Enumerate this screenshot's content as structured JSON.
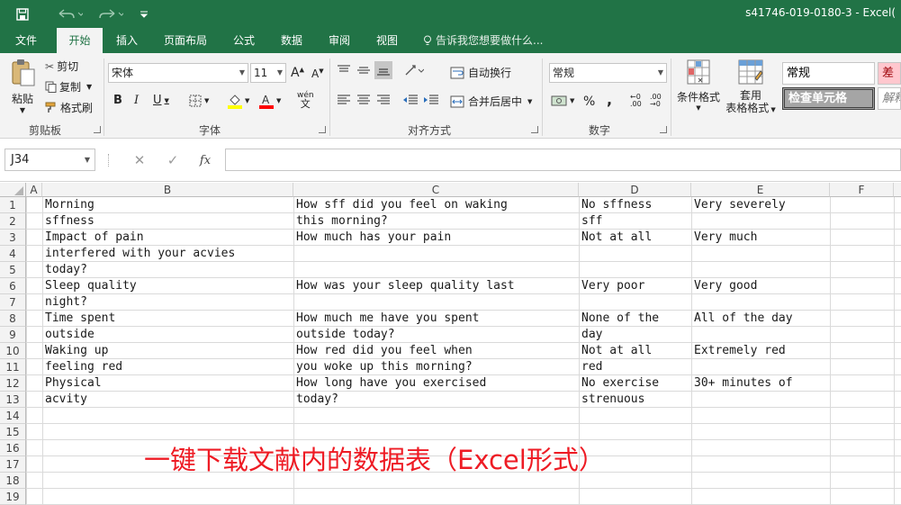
{
  "window": {
    "title": "s41746-019-0180-3 - Excel("
  },
  "quick_access": {
    "save": "save-icon",
    "undo": "undo-icon",
    "redo": "redo-icon",
    "customize": "customize-icon"
  },
  "tabs": [
    "文件",
    "开始",
    "插入",
    "页面布局",
    "公式",
    "数据",
    "审阅",
    "视图"
  ],
  "active_tab": "开始",
  "tell_me": "告诉我您想要做什么...",
  "ribbon": {
    "clipboard": {
      "paste": "粘贴",
      "cut": "剪切",
      "copy": "复制",
      "format_painter": "格式刷",
      "group": "剪贴板"
    },
    "font": {
      "name": "宋体",
      "size": "11",
      "bold": "B",
      "italic": "I",
      "underline": "U",
      "phonetic": "wén",
      "group": "字体"
    },
    "alignment": {
      "wrap_text": "自动换行",
      "merge_center": "合并后居中",
      "group": "对齐方式"
    },
    "number": {
      "format": "常规",
      "group": "数字"
    },
    "styles": {
      "conditional": "条件格式",
      "table_format_1": "套用",
      "table_format_2": "表格格式",
      "style_normal": "常规",
      "style_bad": "差",
      "style_check": "检查单元格",
      "style_explain": "解释"
    }
  },
  "formula_bar": {
    "name_box": "J34",
    "cancel": "✕",
    "confirm": "✓",
    "fx": "fx",
    "value": ""
  },
  "grid": {
    "columns": [
      "A",
      "B",
      "C",
      "D",
      "E",
      "F"
    ],
    "rows": [
      "1",
      "2",
      "3",
      "4",
      "5",
      "6",
      "7",
      "8",
      "9",
      "10",
      "11",
      "12",
      "13",
      "14",
      "15",
      "16",
      "17",
      "18",
      "19"
    ],
    "cells": {
      "B1": "Morning",
      "C1": "How sff did you feel on waking",
      "D1": "No sffness",
      "E1": "Very severely",
      "B2": "sffness",
      "C2": "this morning?",
      "D2": "sff",
      "B3": "Impact of pain",
      "C3": "How much has your pain",
      "D3": "Not at all",
      "E3": "Very much",
      "B4": "interfered with your acvies",
      "B5": "today?",
      "B6": "Sleep quality",
      "C6": "How was your sleep quality last",
      "D6": "Very poor",
      "E6": "Very good",
      "B7": "night?",
      "B8": "Time spent",
      "C8": "How much me have you spent",
      "D8": "None of the",
      "E8": "All of the day",
      "B9": "outside",
      "C9": "outside today?",
      "D9": "day",
      "B10": "Waking up",
      "C10": "How red did you feel when",
      "D10": "Not at all",
      "E10": "Extremely red",
      "B11": "feeling red",
      "C11": "you woke up this morning?",
      "D11": "red",
      "B12": "Physical",
      "C12": "How long have you exercised",
      "D12": "No exercise",
      "E12": "30+ minutes of",
      "B13": "acvity",
      "C13": "today?",
      "D13": "strenuous"
    }
  },
  "overlay_text": "一键下载文献内的数据表（Excel形式）",
  "colors": {
    "excel_green": "#217346",
    "overlay_red": "#ee1b24"
  }
}
